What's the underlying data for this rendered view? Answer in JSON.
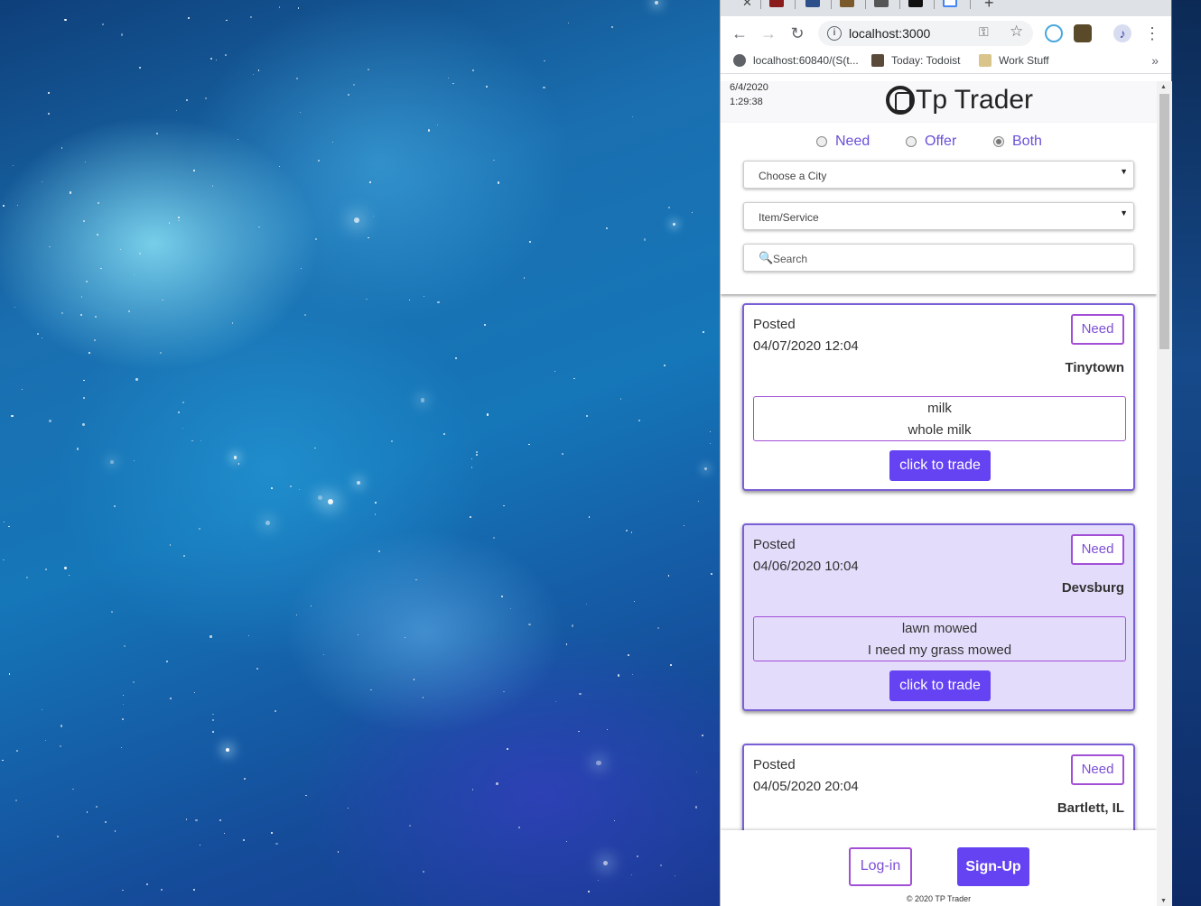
{
  "browser": {
    "url": "localhost:3000",
    "bookmarks": [
      {
        "label": "localhost:60840/(S(t..."
      },
      {
        "label": "Today: Todoist"
      },
      {
        "label": "Work Stuff"
      }
    ],
    "bookmarks_more": "»"
  },
  "header": {
    "date": "6/4/2020",
    "time": "1:29:38",
    "title": "Tp Trader"
  },
  "filters": {
    "radios": [
      {
        "label": "Need",
        "selected": false
      },
      {
        "label": "Offer",
        "selected": false
      },
      {
        "label": "Both",
        "selected": true
      }
    ],
    "city_select": "Choose a City",
    "item_select": "Item/Service",
    "search_placeholder": "Search"
  },
  "posts": [
    {
      "posted_label": "Posted",
      "date": "04/07/2020 12:04",
      "type": "Need",
      "city": "Tinytown",
      "item": "milk",
      "description": "whole milk",
      "action": "click to trade"
    },
    {
      "posted_label": "Posted",
      "date": "04/06/2020 10:04",
      "type": "Need",
      "city": "Devsburg",
      "item": "lawn mowed",
      "description": "I need my grass mowed",
      "action": "click to trade"
    },
    {
      "posted_label": "Posted",
      "date": "04/05/2020 20:04",
      "type": "Need",
      "city": "Bartlett, IL",
      "item": "",
      "description": "",
      "action": ""
    }
  ],
  "footer": {
    "login": "Log-in",
    "signup": "Sign-Up",
    "copyright": "© 2020 TP Trader"
  },
  "colors": {
    "accent": "#6543f2",
    "accent_border": "#a24fd6",
    "highlight_card": "#e3dcfb"
  }
}
